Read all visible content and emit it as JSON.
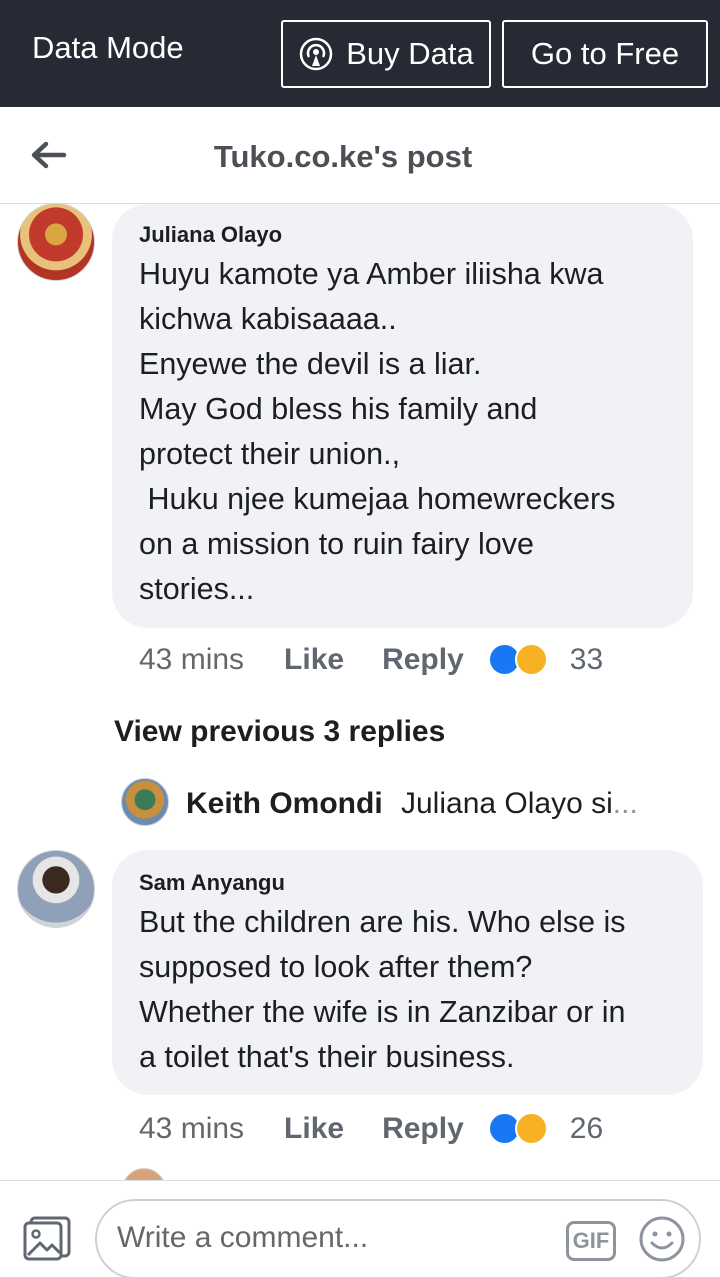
{
  "databar": {
    "mode_label": "Data Mode",
    "buy_label": "Buy Data",
    "free_label": "Go to Free"
  },
  "header": {
    "title": "Tuko.co.ke's post"
  },
  "comments": [
    {
      "author": "Juliana Olayo",
      "text": "Huyu kamote ya Amber iliisha kwa\nkichwa kabisaaaa..\nEnyewe the devil is a liar.\nMay God bless his family and\nprotect their union.,\n Huku njee kumejaa homewreckers\non a mission to ruin fairy love\nstories...",
      "time": "43 mins",
      "like": "Like",
      "reply": "Reply",
      "reaction_count": "33"
    },
    {
      "author": "Sam Anyangu",
      "text": "But the children are his. Who else is\nsupposed to look after them?\nWhether the wife is in Zanzibar or in\na toilet that's their business.",
      "time": "43 mins",
      "like": "Like",
      "reply": "Reply",
      "reaction_count": "26"
    }
  ],
  "replies": {
    "view_previous": "View previous 3 replies",
    "last_reply_author": "Keith Omondi",
    "last_reply_snippet": "Juliana Olayo si",
    "ellipsis": "..."
  },
  "composer": {
    "placeholder": "Write a comment...",
    "gif_label": "GIF"
  },
  "colors": {
    "databar_bg": "#252a34",
    "bubble_bg": "#f0f2f5",
    "like_blue": "#1877f2",
    "haha_yellow": "#f7b125"
  }
}
